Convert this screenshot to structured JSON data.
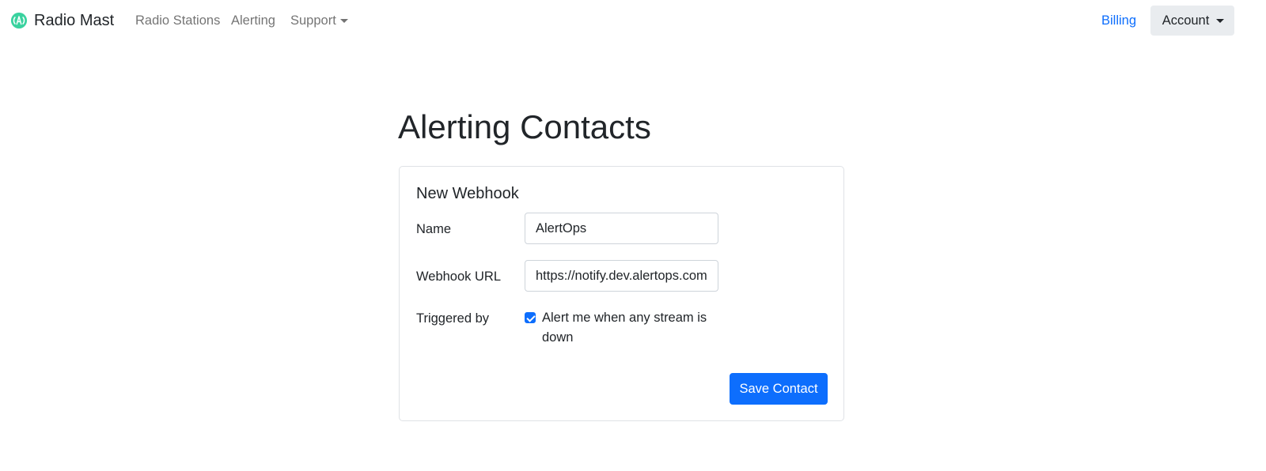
{
  "navbar": {
    "brand": {
      "name": "Radio Mast",
      "logo_icon": "radio-mast-logo-icon",
      "logo_color": "#3ad29f"
    },
    "links": {
      "radio_stations": "Radio Stations",
      "alerting": "Alerting",
      "support": "Support"
    },
    "billing": "Billing",
    "account": "Account"
  },
  "page": {
    "title": "Alerting Contacts"
  },
  "form": {
    "card_title": "New Webhook",
    "name_label": "Name",
    "name_value": "AlertOps",
    "url_label": "Webhook URL",
    "url_value": "https://notify.dev.alertops.com",
    "trigger_label": "Triggered by",
    "trigger_option": "Alert me when any stream is down",
    "trigger_checked": true,
    "save_label": "Save Contact"
  },
  "colors": {
    "primary": "#0d6efd",
    "account_bg": "#e9ecef",
    "nav_muted": "rgba(0,0,0,0.55)"
  }
}
